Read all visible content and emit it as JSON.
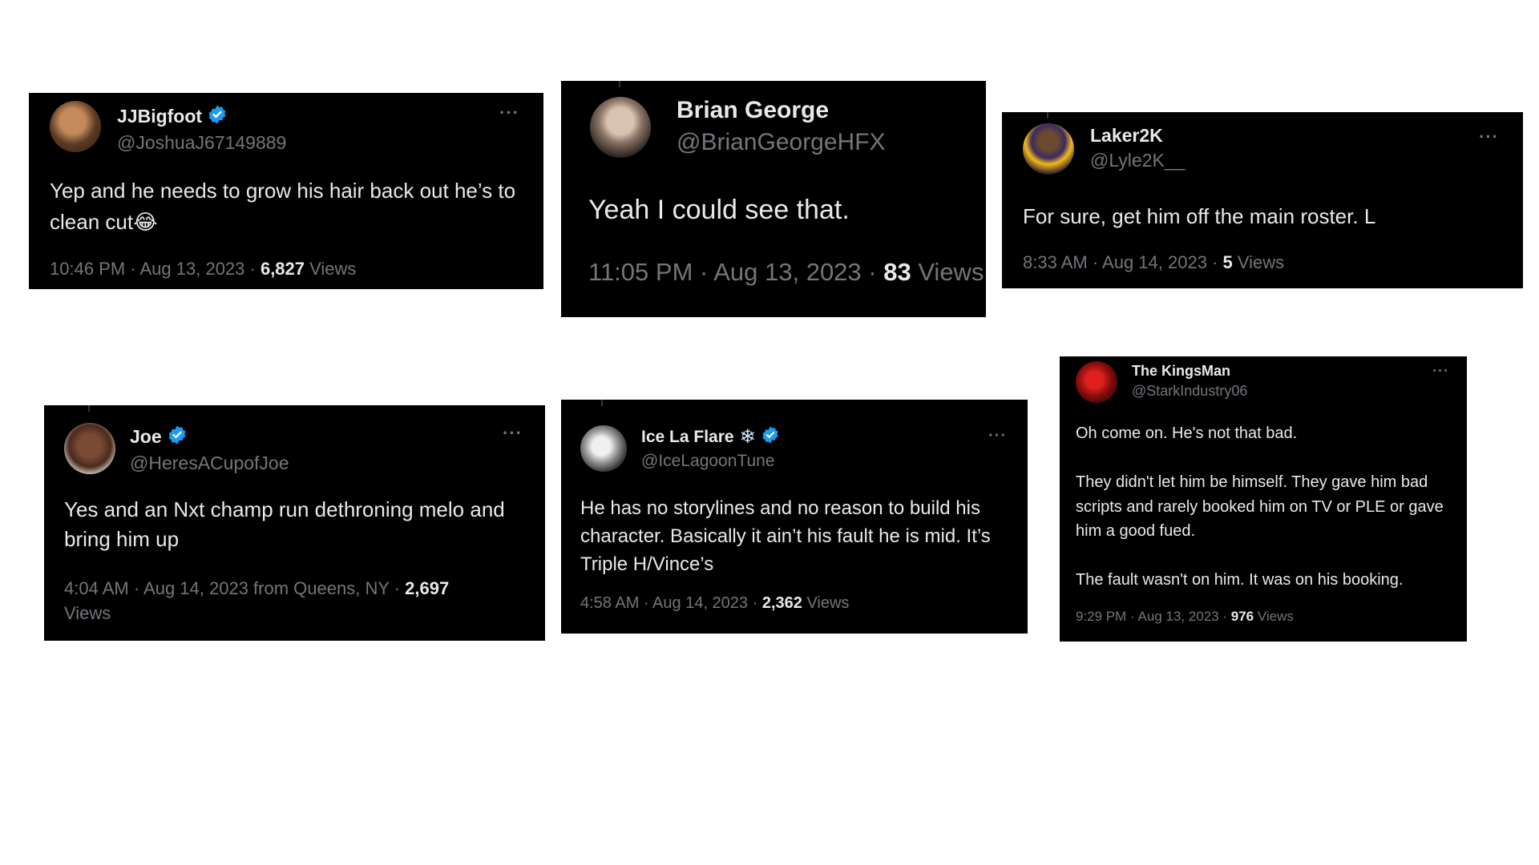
{
  "tweets": [
    {
      "display_name": "JJBigfoot",
      "handle": "@JoshuaJ67149889",
      "verified": true,
      "text": "Yep and he needs to grow his hair back out he’s to clean cut😂",
      "time": "10:46 PM · Aug 13, 2023 · ",
      "views_count": "6,827",
      "views_label": " Views",
      "more": "···"
    },
    {
      "display_name": "Brian George",
      "handle": "@BrianGeorgeHFX",
      "verified": false,
      "text": "Yeah I could see that.",
      "time": "11:05 PM · Aug 13, 2023 · ",
      "views_count": "83",
      "views_label": " Views"
    },
    {
      "display_name": "Laker2K",
      "handle": "@Lyle2K__",
      "verified": false,
      "text": "For sure, get him off the main roster. L",
      "time": "8:33 AM · Aug 14, 2023 · ",
      "views_count": "5",
      "views_label": " Views",
      "more": "···"
    },
    {
      "display_name": "Joe",
      "handle": "@HeresACupofJoe",
      "verified": true,
      "text": "Yes and an Nxt champ run dethroning melo and bring him up",
      "time": "4:04 AM · Aug 14, 2023 from Queens, NY · ",
      "views_count": "2,697",
      "views_label": "Views",
      "more": "···"
    },
    {
      "display_name": "Ice La Flare",
      "handle": "@IceLagoonTune",
      "verified": true,
      "text": "He has no storylines and no reason to build his character. Basically it ain’t his fault he is mid. It’s Triple H/Vince’s",
      "time": "4:58 AM · Aug 14, 2023 · ",
      "views_count": "2,362",
      "views_label": " Views",
      "more": "···"
    },
    {
      "display_name": "The KingsMan",
      "handle": "@StarkIndustry06",
      "verified": false,
      "text": "Oh come on. He's not that bad.\n\nThey didn't let him be himself. They gave him bad scripts and rarely booked him on TV or PLE or gave him a good fued.\n\nThe fault wasn't on him. It was on his booking.",
      "time": "9:29 PM · Aug 13, 2023 · ",
      "views_count": "976",
      "views_label": " Views",
      "more": "···"
    }
  ],
  "colors": {
    "background": "#000000",
    "text": "#e7e9ea",
    "muted": "#71767b",
    "verified": "#1d9bf0"
  }
}
